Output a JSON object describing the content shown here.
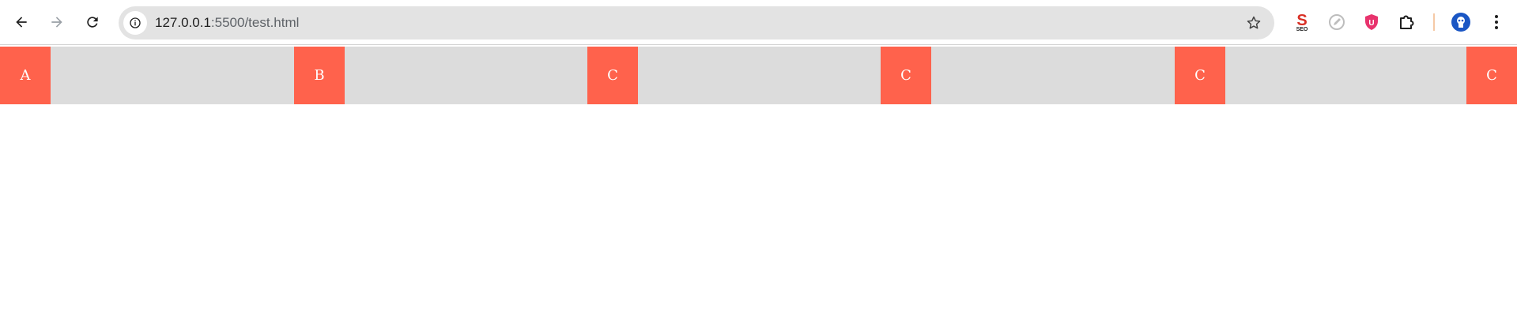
{
  "browser": {
    "url_host": "127.0.0.1",
    "url_rest": ":5500/test.html",
    "icons": [
      "back-arrow-icon",
      "forward-arrow-icon",
      "reload-icon",
      "info-icon",
      "star-icon",
      "seo-extension-icon",
      "pen-extension-icon",
      "shield-extension-icon",
      "puzzle-icon",
      "profile-avatar-icon",
      "kebab-menu-icon"
    ]
  },
  "page": {
    "bar_color": "#dcdcdc",
    "box_color": "#ff624c",
    "boxes": [
      {
        "label": "A"
      },
      {
        "label": "B"
      },
      {
        "label": "C"
      },
      {
        "label": "C"
      },
      {
        "label": "C"
      },
      {
        "label": "C"
      }
    ]
  }
}
